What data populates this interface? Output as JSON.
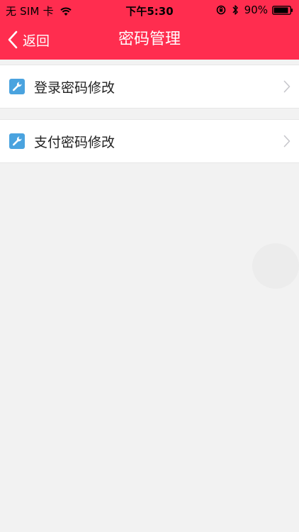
{
  "status_bar": {
    "carrier": "无 SIM 卡",
    "time": "下午5:30",
    "battery_percent": "90%",
    "battery_level": 0.9
  },
  "nav": {
    "back_label": "返回",
    "title": "密码管理"
  },
  "menu": {
    "items": [
      {
        "label": "登录密码修改",
        "icon": "wrench-icon"
      },
      {
        "label": "支付密码修改",
        "icon": "wrench-icon"
      }
    ]
  },
  "colors": {
    "header_bg": "#ff2d4f",
    "icon_bg": "#4aa3df",
    "page_bg": "#f2f2f2"
  }
}
